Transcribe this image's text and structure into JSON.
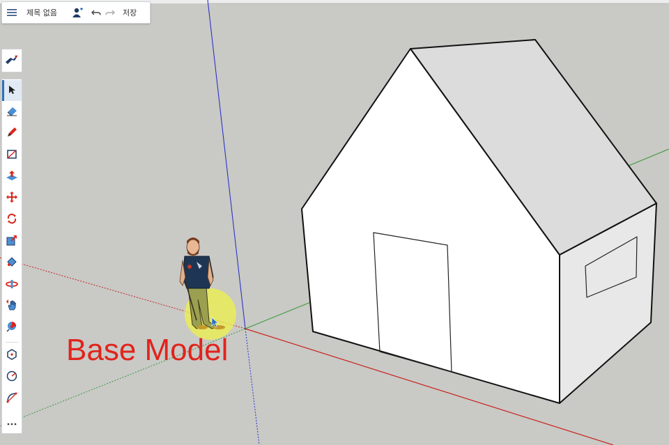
{
  "header": {
    "title": "제목 없음",
    "save_label": "저장",
    "icons": [
      "menu-icon",
      "user-share-icon",
      "undo-icon",
      "redo-icon"
    ]
  },
  "toolbar": {
    "logo_icon": "sketchup-logo-icon",
    "tools": [
      {
        "name": "select-tool",
        "icon": "arrow-cursor-icon",
        "active": true
      },
      {
        "name": "eraser-tool",
        "icon": "eraser-icon"
      },
      {
        "name": "pencil-tool",
        "icon": "pencil-icon"
      },
      {
        "name": "rectangle-tool",
        "icon": "rectangle-icon"
      },
      {
        "name": "push-pull-tool",
        "icon": "push-pull-icon"
      },
      {
        "name": "move-tool",
        "icon": "move-arrows-icon"
      },
      {
        "name": "rotate-tool",
        "icon": "rotate-icon"
      },
      {
        "name": "scale-tool",
        "icon": "scale-icon"
      },
      {
        "name": "paint-bucket-tool",
        "icon": "paint-bucket-icon"
      },
      {
        "name": "orbit-tool",
        "icon": "orbit-icon"
      },
      {
        "name": "pan-tool",
        "icon": "pan-hand-icon"
      },
      {
        "name": "zoom-tool",
        "icon": "zoom-target-icon"
      },
      {
        "name": "polygon-tool",
        "icon": "polygon-icon"
      },
      {
        "name": "circle-tool",
        "icon": "circle-icon"
      },
      {
        "name": "arc-tool",
        "icon": "arc-icon"
      },
      {
        "name": "more-tools",
        "icon": "ellipsis-icon"
      }
    ]
  },
  "overlay": {
    "caption": "Base Model"
  },
  "colors": {
    "background": "#c9c9c6",
    "axis_red": "#c8211b",
    "axis_green": "#3a9a3a",
    "axis_blue": "#2b35c4",
    "accent_blue": "#2a72b8",
    "tool_red": "#d9261c",
    "highlight_yellow": "#eef04a"
  }
}
